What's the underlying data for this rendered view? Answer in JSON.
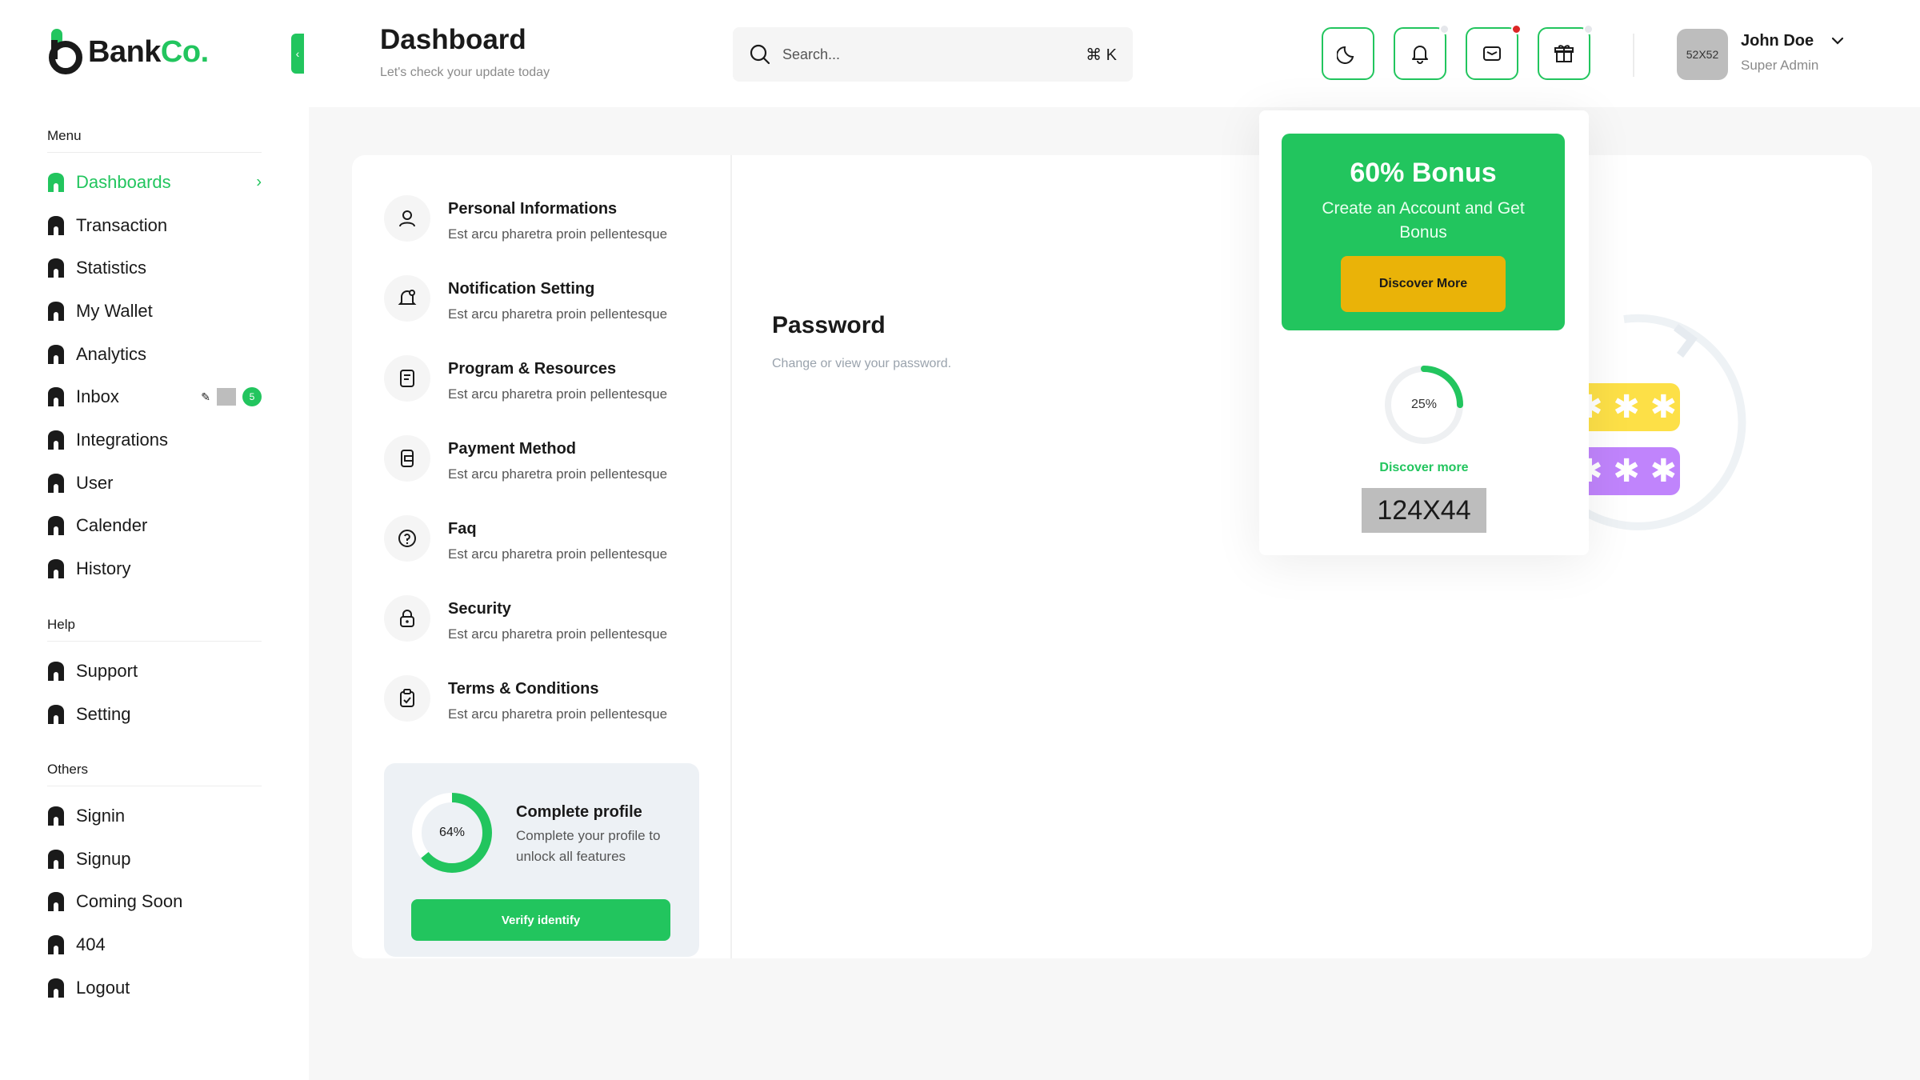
{
  "brand": {
    "name_main": "Bank",
    "name_accent": "Co."
  },
  "header": {
    "title": "Dashboard",
    "subtitle": "Let's check your update today",
    "search_placeholder": "Search...",
    "search_shortcut": "⌘ K",
    "user_name": "John Doe",
    "user_role": "Super Admin",
    "avatar_text": "52X52"
  },
  "sidebar": {
    "menu_heading": "Menu",
    "menu_items": [
      {
        "label": "Dashboards",
        "active": true
      },
      {
        "label": "Transaction"
      },
      {
        "label": "Statistics"
      },
      {
        "label": "My Wallet"
      },
      {
        "label": "Analytics"
      },
      {
        "label": "Inbox",
        "badge": "5"
      },
      {
        "label": "Integrations"
      },
      {
        "label": "User"
      },
      {
        "label": "Calender"
      },
      {
        "label": "History"
      }
    ],
    "help_heading": "Help",
    "help_items": [
      {
        "label": "Support"
      },
      {
        "label": "Setting"
      }
    ],
    "others_heading": "Others",
    "other_items": [
      {
        "label": "Signin"
      },
      {
        "label": "Signup"
      },
      {
        "label": "Coming Soon"
      },
      {
        "label": "404"
      },
      {
        "label": "Logout"
      }
    ]
  },
  "settings": {
    "items": [
      {
        "title": "Personal Informations",
        "desc": "Est arcu pharetra proin pellentesque"
      },
      {
        "title": "Notification Setting",
        "desc": "Est arcu pharetra proin pellentesque"
      },
      {
        "title": "Program & Resources",
        "desc": "Est arcu pharetra proin pellentesque"
      },
      {
        "title": "Payment Method",
        "desc": "Est arcu pharetra proin pellentesque"
      },
      {
        "title": "Faq",
        "desc": "Est arcu pharetra proin pellentesque"
      },
      {
        "title": "Security",
        "desc": "Est arcu pharetra proin pellentesque"
      },
      {
        "title": "Terms & Conditions",
        "desc": "Est arcu pharetra proin pellentesque"
      }
    ],
    "profile": {
      "percent_label": "64%",
      "percent": 64,
      "title": "Complete profile",
      "desc": "Complete your profile to unlock all features",
      "button": "Verify identify"
    }
  },
  "password": {
    "title": "Password",
    "subtitle": "Change or view your password."
  },
  "popover": {
    "bonus_title": "60% Bonus",
    "bonus_desc": "Create an Account and Get Bonus",
    "bonus_button": "Discover More",
    "percent_label": "25%",
    "percent": 25,
    "link": "Discover more",
    "image_text": "124X44"
  },
  "colors": {
    "accent": "#22c55e",
    "warning": "#eab308",
    "danger": "#dc2626"
  }
}
